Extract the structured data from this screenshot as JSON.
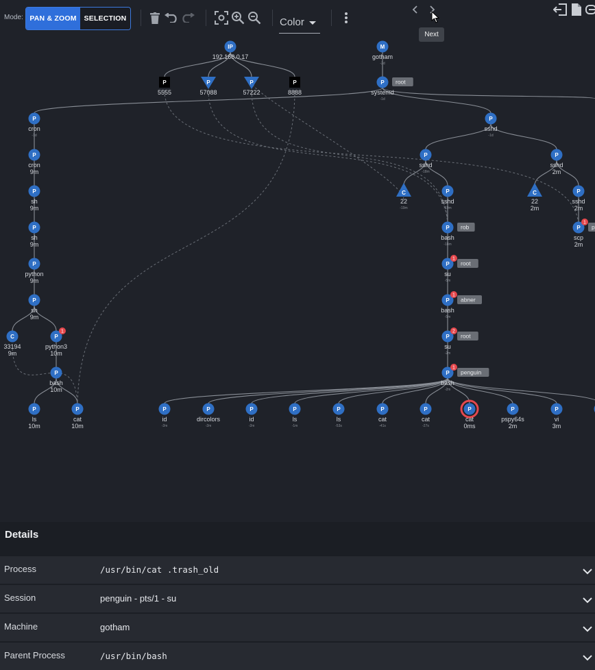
{
  "toolbar": {
    "mode_label": "Mode:",
    "pan_zoom_label": "PAN & ZOOM",
    "selection_label": "SELECTION",
    "color_label": "Color",
    "tooltip_next": "Next"
  },
  "graph": {
    "nodes": [
      {
        "id": "ip",
        "shape": "circle",
        "letter": "IP",
        "label": "192.168.0.17",
        "sub": ""
      },
      {
        "id": "p5555",
        "shape": "square",
        "letter": "P",
        "label": "5555",
        "sub": ""
      },
      {
        "id": "p57088",
        "shape": "tri-down",
        "letter": "P",
        "label": "57088",
        "sub": ""
      },
      {
        "id": "p57222",
        "shape": "tri-down",
        "letter": "P",
        "label": "57222",
        "sub": ""
      },
      {
        "id": "p8888",
        "shape": "square",
        "letter": "P",
        "label": "8888",
        "sub": ""
      },
      {
        "id": "gotham",
        "shape": "circle",
        "letter": "M",
        "label": "gotham",
        "sub": "-2d"
      },
      {
        "id": "systemd",
        "shape": "circle",
        "letter": "P",
        "label": "systemd",
        "sub": "-1d",
        "tag": "root"
      },
      {
        "id": "cron1",
        "shape": "circle",
        "letter": "P",
        "label": "cron",
        "sub": "-1d"
      },
      {
        "id": "cron2",
        "shape": "circle",
        "letter": "P",
        "label": "cron",
        "sub": "9m"
      },
      {
        "id": "sh1",
        "shape": "circle",
        "letter": "P",
        "label": "sh",
        "sub": "9m"
      },
      {
        "id": "sh2",
        "shape": "circle",
        "letter": "P",
        "label": "sh",
        "sub": "9m"
      },
      {
        "id": "python",
        "shape": "circle",
        "letter": "P",
        "label": "python",
        "sub": "9m"
      },
      {
        "id": "sh3",
        "shape": "circle",
        "letter": "P",
        "label": "sh",
        "sub": "9m"
      },
      {
        "id": "c33194",
        "shape": "circle",
        "letter": "C",
        "label": "33194",
        "sub": "9m"
      },
      {
        "id": "python3",
        "shape": "circle",
        "letter": "P",
        "label": "python3",
        "sub": "10m",
        "badge": "1"
      },
      {
        "id": "bashL",
        "shape": "circle",
        "letter": "P",
        "label": "bash",
        "sub": "10m"
      },
      {
        "id": "lsL",
        "shape": "circle",
        "letter": "P",
        "label": "ls",
        "sub": "10m"
      },
      {
        "id": "catL",
        "shape": "circle",
        "letter": "P",
        "label": "cat",
        "sub": "10m"
      },
      {
        "id": "sshdTop",
        "shape": "circle",
        "letter": "P",
        "label": "sshd",
        "sub": "-1d"
      },
      {
        "id": "sshdA",
        "shape": "circle",
        "letter": "P",
        "label": "sshd",
        "sub": "-18m"
      },
      {
        "id": "sshdB",
        "shape": "circle",
        "letter": "P",
        "label": "sshd",
        "sub": "2m"
      },
      {
        "id": "c22a",
        "shape": "triangle",
        "letter": "C",
        "label": "22",
        "sub": "-19m"
      },
      {
        "id": "sshdA2",
        "shape": "circle",
        "letter": "P",
        "label": "sshd",
        "sub": "-19m"
      },
      {
        "id": "c22b",
        "shape": "triangle",
        "letter": "C",
        "label": "22",
        "sub": "2m"
      },
      {
        "id": "sshdB2",
        "shape": "circle",
        "letter": "P",
        "label": "sshd",
        "sub": "2m"
      },
      {
        "id": "scp",
        "shape": "circle",
        "letter": "P",
        "label": "scp",
        "sub": "2m",
        "badge": "1",
        "tag": "p"
      },
      {
        "id": "bashRob",
        "shape": "circle",
        "letter": "P",
        "label": "bash",
        "sub": "-18m",
        "tag": "rob"
      },
      {
        "id": "suRoot",
        "shape": "circle",
        "letter": "P",
        "label": "su",
        "sub": "-5m",
        "badge": "1",
        "tag": "root"
      },
      {
        "id": "bashAbner",
        "shape": "circle",
        "letter": "P",
        "label": "bash",
        "sub": "-5m",
        "badge": "1",
        "tag": "abner"
      },
      {
        "id": "suRoot2",
        "shape": "circle",
        "letter": "P",
        "label": "su",
        "sub": "-2m",
        "badge": "2",
        "tag": "root"
      },
      {
        "id": "bashPenguin",
        "shape": "circle",
        "letter": "P",
        "label": "bash",
        "sub": "-2m",
        "badge": "1",
        "tag": "penguin"
      },
      {
        "id": "id1",
        "shape": "circle",
        "letter": "P",
        "label": "id",
        "sub": "-2m"
      },
      {
        "id": "dircolors",
        "shape": "circle",
        "letter": "P",
        "label": "dircolors",
        "sub": "-2m"
      },
      {
        "id": "id2",
        "shape": "circle",
        "letter": "P",
        "label": "id",
        "sub": "-2m"
      },
      {
        "id": "ls1",
        "shape": "circle",
        "letter": "P",
        "label": "ls",
        "sub": "-1m"
      },
      {
        "id": "ls2",
        "shape": "circle",
        "letter": "P",
        "label": "ls",
        "sub": "-53s"
      },
      {
        "id": "cat1",
        "shape": "circle",
        "letter": "P",
        "label": "cat",
        "sub": "-41s"
      },
      {
        "id": "cat2",
        "shape": "circle",
        "letter": "P",
        "label": "cat",
        "sub": "-27s"
      },
      {
        "id": "catSel",
        "shape": "circle",
        "letter": "P",
        "label": "cat",
        "sub": "0ms",
        "selected": true
      },
      {
        "id": "pspy",
        "shape": "circle",
        "letter": "P",
        "label": "pspy64s",
        "sub": "2m"
      },
      {
        "id": "vi",
        "shape": "circle",
        "letter": "P",
        "label": "vi",
        "sub": "3m"
      },
      {
        "id": "edge",
        "shape": "circle",
        "letter": "P",
        "label": "",
        "sub": ""
      }
    ]
  },
  "details": {
    "title": "Details",
    "rows": [
      {
        "label": "Process",
        "value": "/usr/bin/cat .trash_old"
      },
      {
        "label": "Session",
        "value": "penguin - pts/1 - su"
      },
      {
        "label": "Machine",
        "value": "gotham"
      },
      {
        "label": "Parent Process",
        "value": "/usr/bin/bash"
      }
    ]
  },
  "colors": {
    "node_fill": "#2f6fc4",
    "square_fill": "#000000",
    "badge": "#e5484d",
    "selected_ring": "#e5484d",
    "tag_bg": "#6a6e75",
    "edge": "#8a8f97",
    "background": "#1f2229"
  }
}
